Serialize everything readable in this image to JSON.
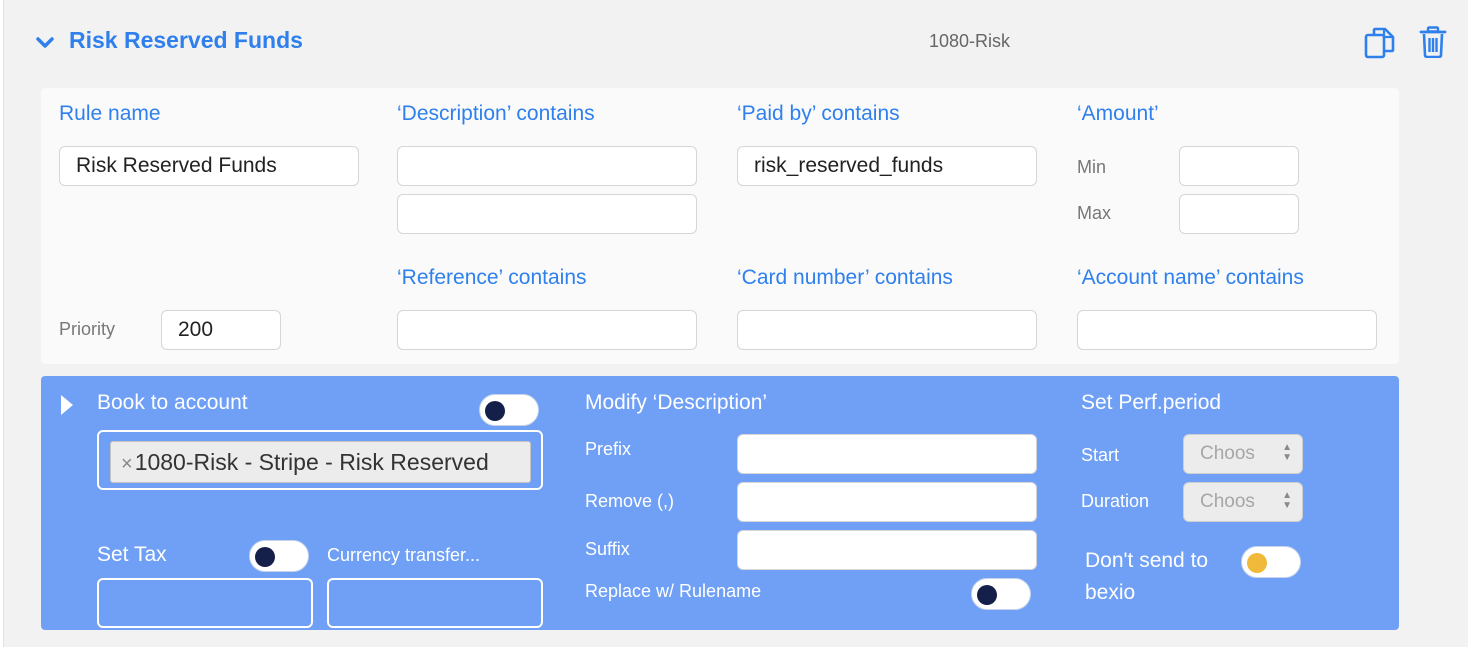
{
  "header": {
    "title": "Risk Reserved Funds",
    "account_code": "1080-Risk"
  },
  "filters": {
    "rule_name_label": "Rule name",
    "rule_name_value": "Risk Reserved Funds",
    "description_label": "‘Description’ contains",
    "paid_by_label": "‘Paid by’ contains",
    "paid_by_value": "risk_reserved_funds",
    "amount_label": "‘Amount’",
    "amount_min_label": "Min",
    "amount_max_label": "Max",
    "reference_label": "‘Reference’ contains",
    "card_number_label": "‘Card number’ contains",
    "account_name_label": "‘Account name’ contains",
    "priority_label": "Priority",
    "priority_value": "200"
  },
  "actions": {
    "book_to_account_label": "Book to account",
    "book_to_account_tag": "1080-Risk - Stripe - Risk Reserved",
    "tag_remove_glyph": "×",
    "set_tax_label": "Set Tax",
    "currency_transfer_label": "Currency transfer...",
    "modify_description_label": "Modify ‘Description’",
    "prefix_label": "Prefix",
    "remove_label": "Remove (,)",
    "suffix_label": "Suffix",
    "replace_label": "Replace w/ Rulename",
    "perf_period_label": "Set Perf.period",
    "start_label": "Start",
    "duration_label": "Duration",
    "select_placeholder": "Choos",
    "dont_send_label_line1": "Don't send to",
    "dont_send_label_line2": "bexio"
  },
  "colors": {
    "accent": "#2f80ed",
    "panel_blue": "#6fa0f5",
    "toggle_knob_dark": "#14204a",
    "toggle_knob_yellow": "#f0b93a"
  },
  "icons": {
    "collapse": "chevron-down-icon",
    "expand": "caret-right-icon",
    "copy": "copy-icon",
    "delete": "trash-icon"
  }
}
